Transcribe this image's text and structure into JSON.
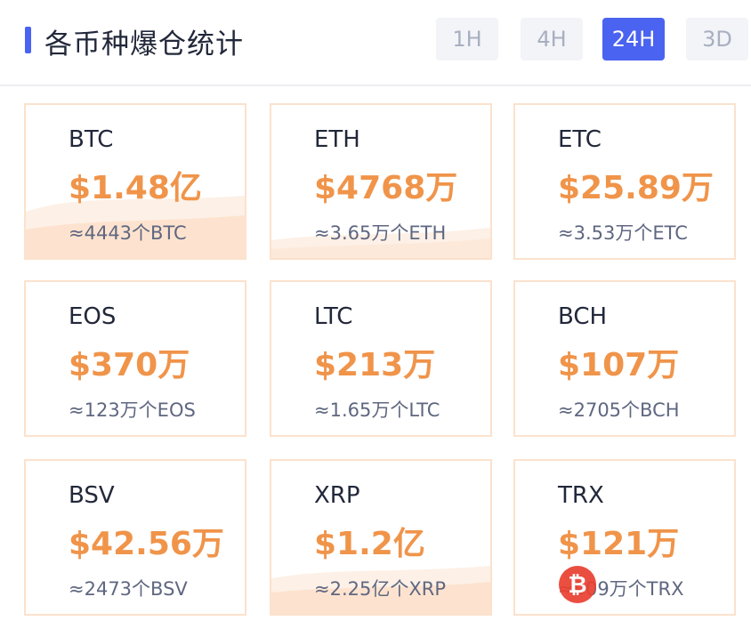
{
  "header": {
    "title": "各币种爆仓统计"
  },
  "tabs": [
    {
      "label": "1H",
      "active": false
    },
    {
      "label": "4H",
      "active": false
    },
    {
      "label": "24H",
      "active": true
    },
    {
      "label": "3D",
      "active": false
    }
  ],
  "cards": [
    {
      "symbol": "BTC",
      "amount": "$1.48亿",
      "quantity": "≈4443个BTC"
    },
    {
      "symbol": "ETH",
      "amount": "$4768万",
      "quantity": "≈3.65万个ETH"
    },
    {
      "symbol": "ETC",
      "amount": "$25.89万",
      "quantity": "≈3.53万个ETC"
    },
    {
      "symbol": "EOS",
      "amount": "$370万",
      "quantity": "≈123万个EOS"
    },
    {
      "symbol": "LTC",
      "amount": "$213万",
      "quantity": "≈1.65万个LTC"
    },
    {
      "symbol": "BCH",
      "amount": "$107万",
      "quantity": "≈2705个BCH"
    },
    {
      "symbol": "BSV",
      "amount": "$42.56万",
      "quantity": "≈2473个BSV"
    },
    {
      "symbol": "XRP",
      "amount": "$1.2亿",
      "quantity": "≈2.25亿个XRP"
    },
    {
      "symbol": "TRX",
      "amount": "$121万",
      "quantity": "≈909万个TRX"
    }
  ],
  "colors": {
    "accent": "#4a63f0",
    "amount": "#f0944a",
    "card_border": "#fbe2cd",
    "wave": "#fde3cf"
  },
  "watermark_icon": "bitcoin-icon"
}
